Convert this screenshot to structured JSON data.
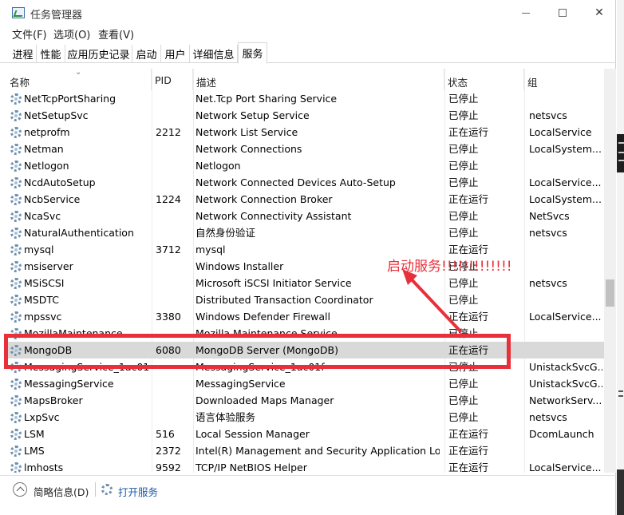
{
  "window": {
    "title": "任务管理器"
  },
  "menu": {
    "file": "文件(F)",
    "options": "选项(O)",
    "view": "查看(V)"
  },
  "tabs": [
    "进程",
    "性能",
    "应用历史记录",
    "启动",
    "用户",
    "详细信息",
    "服务"
  ],
  "active_tab": "服务",
  "columns": {
    "name": "名称",
    "pid": "PID",
    "desc": "描述",
    "status": "状态",
    "group": "组"
  },
  "rows": [
    {
      "name": "NetTcpPortSharing",
      "pid": "",
      "desc": "Net.Tcp Port Sharing Service",
      "status": "已停止",
      "group": ""
    },
    {
      "name": "NetSetupSvc",
      "pid": "",
      "desc": "Network Setup Service",
      "status": "已停止",
      "group": "netsvcs"
    },
    {
      "name": "netprofm",
      "pid": "2212",
      "desc": "Network List Service",
      "status": "正在运行",
      "group": "LocalService"
    },
    {
      "name": "Netman",
      "pid": "",
      "desc": "Network Connections",
      "status": "已停止",
      "group": "LocalSystem..."
    },
    {
      "name": "Netlogon",
      "pid": "",
      "desc": "Netlogon",
      "status": "已停止",
      "group": ""
    },
    {
      "name": "NcdAutoSetup",
      "pid": "",
      "desc": "Network Connected Devices Auto-Setup",
      "status": "已停止",
      "group": "LocalService..."
    },
    {
      "name": "NcbService",
      "pid": "1224",
      "desc": "Network Connection Broker",
      "status": "正在运行",
      "group": "LocalSystem..."
    },
    {
      "name": "NcaSvc",
      "pid": "",
      "desc": "Network Connectivity Assistant",
      "status": "已停止",
      "group": "NetSvcs"
    },
    {
      "name": "NaturalAuthentication",
      "pid": "",
      "desc": "自然身份验证",
      "status": "已停止",
      "group": "netsvcs"
    },
    {
      "name": "mysql",
      "pid": "3712",
      "desc": "mysql",
      "status": "正在运行",
      "group": ""
    },
    {
      "name": "msiserver",
      "pid": "",
      "desc": "Windows Installer",
      "status": "已停止",
      "group": ""
    },
    {
      "name": "MSiSCSI",
      "pid": "",
      "desc": "Microsoft iSCSI Initiator Service",
      "status": "已停止",
      "group": "netsvcs"
    },
    {
      "name": "MSDTC",
      "pid": "",
      "desc": "Distributed Transaction Coordinator",
      "status": "已停止",
      "group": ""
    },
    {
      "name": "mpssvc",
      "pid": "3380",
      "desc": "Windows Defender Firewall",
      "status": "正在运行",
      "group": "LocalService..."
    },
    {
      "name": "MozillaMaintenance",
      "pid": "",
      "desc": "Mozilla Maintenance Service",
      "status": "已停止",
      "group": ""
    },
    {
      "name": "MongoDB",
      "pid": "6080",
      "desc": "MongoDB Server (MongoDB)",
      "status": "正在运行",
      "group": ""
    },
    {
      "name": "MessagingService_1ac01",
      "pid": "",
      "desc": "MessagingService_1ac01f",
      "status": "已停止",
      "group": "UnistackSvcG..."
    },
    {
      "name": "MessagingService",
      "pid": "",
      "desc": "MessagingService",
      "status": "已停止",
      "group": "UnistackSvcG..."
    },
    {
      "name": "MapsBroker",
      "pid": "",
      "desc": "Downloaded Maps Manager",
      "status": "已停止",
      "group": "NetworkServ..."
    },
    {
      "name": "LxpSvc",
      "pid": "",
      "desc": "语言体验服务",
      "status": "已停止",
      "group": "netsvcs"
    },
    {
      "name": "LSM",
      "pid": "516",
      "desc": "Local Session Manager",
      "status": "正在运行",
      "group": "DcomLaunch"
    },
    {
      "name": "LMS",
      "pid": "2372",
      "desc": "Intel(R) Management and Security Application Loc...",
      "status": "正在运行",
      "group": ""
    },
    {
      "name": "lmhosts",
      "pid": "9592",
      "desc": "TCP/IP NetBIOS Helper",
      "status": "正在运行",
      "group": "LocalService..."
    }
  ],
  "selected_row": "MongoDB",
  "annotation": {
    "text": "启动服务!!!!!!!!!!!!!",
    "color": "#e8303a"
  },
  "footer": {
    "fewer_details": "简略信息(D)",
    "open_services": "打开服务"
  }
}
